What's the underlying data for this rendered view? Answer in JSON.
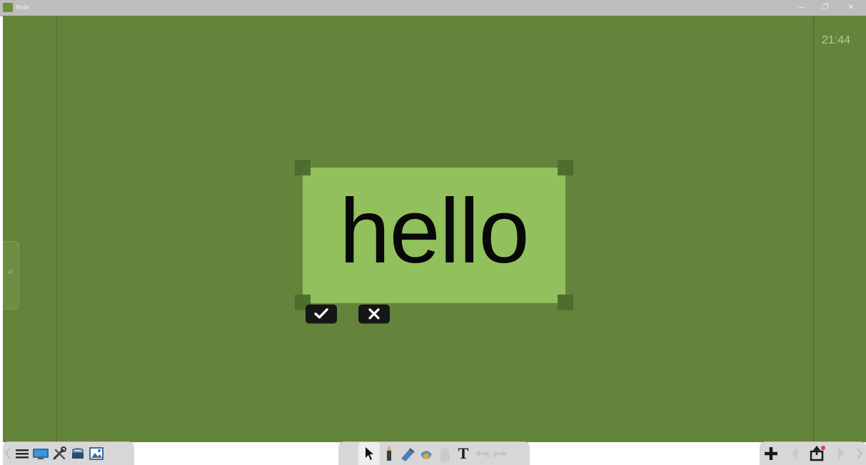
{
  "window": {
    "title": "Note",
    "controls": {
      "minimize": "—",
      "maximize": "❐",
      "close": "✕"
    }
  },
  "clock": "21:44",
  "canvas": {
    "background": "#65843b",
    "side_handle_label": "⇄"
  },
  "text_box": {
    "text": "hello",
    "fill": "#92c05c"
  },
  "actions": {
    "confirm_icon": "check-icon",
    "cancel_icon": "close-icon"
  },
  "toolbars": {
    "left": [
      "menu-icon",
      "screen-icon",
      "tools-icon",
      "folder-icon",
      "image-icon"
    ],
    "center": [
      "select-icon",
      "pen-icon",
      "highlighter-icon",
      "eraser-icon",
      "hand-icon",
      "text-icon",
      "undo-icon",
      "redo-icon"
    ],
    "text_tool_label": "T",
    "right": [
      "add-page-icon",
      "prev-page-icon",
      "export-icon",
      "next-page-icon"
    ]
  },
  "colors": {
    "titlebar": "#bdbdbd",
    "toolbar": "#d7d7d7",
    "selection_handles": "#4d6a2c"
  }
}
